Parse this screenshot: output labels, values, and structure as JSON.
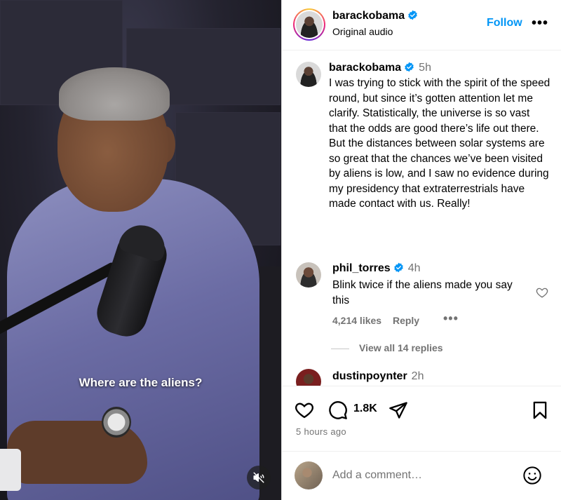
{
  "video": {
    "caption": "Where are the aliens?",
    "mute_icon": "speaker-muted-icon"
  },
  "header": {
    "username": "barackobama",
    "subtitle": "Original audio",
    "follow_label": "Follow",
    "more_label": "•••"
  },
  "post_caption": {
    "username": "barackobama",
    "time": "5h",
    "text": "I was trying to stick with the spirit of the speed round, but since it’s gotten attention let me clarify. Statistically, the universe is so vast that the odds are good there’s life out there. But the distances between solar systems are so great that the chances we’ve been visited by aliens is low, and I saw no evidence during my presidency that extraterrestrials have made contact with us. Really!"
  },
  "comments": [
    {
      "username": "phil_torres",
      "time": "4h",
      "text": "Blink twice if the aliens made you say this",
      "likes": "4,214 likes",
      "reply_label": "Reply",
      "more_label": "•••",
      "view_replies": "View all 14 replies"
    },
    {
      "username": "dustinpoynter",
      "time": "2h"
    }
  ],
  "actions": {
    "comment_count": "1.8K",
    "posted": "5 hours ago"
  },
  "add_comment": {
    "placeholder": "Add a comment…"
  },
  "colors": {
    "accent": "#0095f6",
    "verified": "#0095f6",
    "secondary_text": "#737373"
  }
}
